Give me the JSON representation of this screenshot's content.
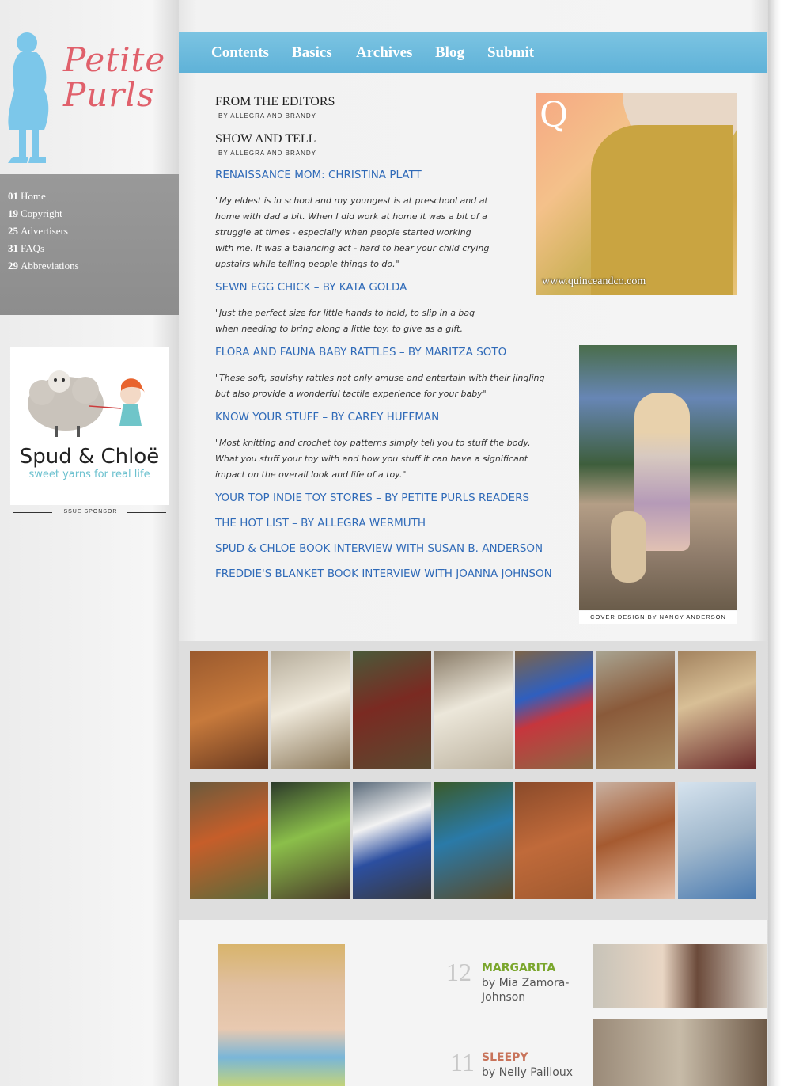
{
  "site": {
    "logo_line1": "Petite",
    "logo_line2": "Purls",
    "logo_color": "#e0606b",
    "silhouette_color": "#7cc7ea"
  },
  "sidebar_nav": [
    {
      "num": "01",
      "label": "Home"
    },
    {
      "num": "19",
      "label": "Copyright"
    },
    {
      "num": "25",
      "label": "Advertisers"
    },
    {
      "num": "31",
      "label": "FAQs"
    },
    {
      "num": "29",
      "label": "Abbreviations"
    }
  ],
  "sponsor": {
    "name": "Spud & Chloë",
    "tagline": "sweet yarns for real life",
    "label": "ISSUE SPONSOR"
  },
  "topnav": [
    "Contents",
    "Basics",
    "Archives",
    "Blog",
    "Submit"
  ],
  "contents": {
    "editors_title": "FROM THE EDITORS",
    "editors_by": "BY ALLEGRA AND BRANDY",
    "show_title": "SHOW AND TELL",
    "show_by": "BY ALLEGRA AND BRANDY",
    "articles": [
      {
        "title": "RENAISSANCE MOM: CHRISTINA PLATT",
        "quote": "\"My eldest is in school and my youngest is at preschool and at home with dad a bit. When I did work at home it was a bit of a struggle at times - especially when people started working with me. It was a balancing act - hard to hear your child crying upstairs while telling people things to do.\""
      },
      {
        "title": "SEWN EGG CHICK – BY KATA GOLDA",
        "quote": "\"Just the perfect size for little hands to hold, to slip in a bag when needing to bring along a little toy, to give as a gift."
      },
      {
        "title": "FLORA AND FAUNA BABY RATTLES – BY MARITZA SOTO",
        "quote": "\"These soft, squishy rattles not only amuse and entertain with their jingling but also provide a wonderful tactile experience for your baby\""
      },
      {
        "title": "KNOW YOUR STUFF – BY CAREY HUFFMAN",
        "quote": "\"Most knitting and crochet toy patterns simply tell you to stuff the body. What you stuff your toy with and how you stuff it can have a significant impact on the overall look and life of a toy.\""
      },
      {
        "title": "YOUR TOP INDIE TOY STORES – BY PETITE PURLS READERS"
      },
      {
        "title": "THE HOT LIST – BY ALLEGRA WERMUTH"
      },
      {
        "title": "SPUD & CHLOE BOOK INTERVIEW WITH SUSAN B. ANDERSON"
      },
      {
        "title": "FREDDIE'S BLANKET BOOK INTERVIEW WITH JOANNA JOHNSON"
      }
    ]
  },
  "ad": {
    "letter": "Q",
    "url": "www.quinceandco.com"
  },
  "cover": {
    "credit": "COVER DESIGN BY NANCY ANDERSON"
  },
  "thumbnails": {
    "row1": [
      "#8a4b2a",
      "#d8d2c3",
      "#6b3a2a",
      "#e6e2d6",
      "#3a66b5",
      "#8d7050",
      "#c9a880"
    ],
    "row2": [
      "#7a6a4a",
      "#3b5a3a",
      "#6a7a8a",
      "#6b5a3a",
      "#b0582a",
      "#d9a58a",
      "#b7c7d8"
    ]
  },
  "patterns": [
    {
      "num": "12",
      "title": "MARGARITA",
      "by": "by Mia Zamora-Johnson",
      "color": "#7aa62c"
    },
    {
      "num": "11",
      "title": "SLEEPY",
      "by": "by Nelly Pailloux",
      "color": "#c8735a"
    }
  ]
}
